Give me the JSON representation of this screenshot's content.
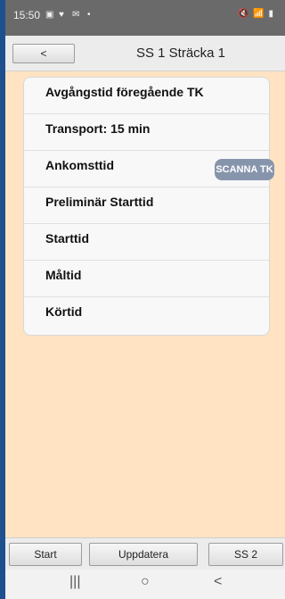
{
  "status_bar": {
    "time": "15:50",
    "notification_icons": [
      "image-icon",
      "twitter-icon",
      "mail-icon",
      "dot-icon"
    ],
    "right_icons": [
      "mute-icon",
      "wifi-icon",
      "volte-icon",
      "signal-icon",
      "battery-icon"
    ]
  },
  "header": {
    "back_label": "<",
    "title": "SS 1 Sträcka 1"
  },
  "card": {
    "rows": [
      {
        "label": "Avgångstid föregående TK"
      },
      {
        "label": "Transport: 15 min"
      },
      {
        "label": "Ankomsttid"
      },
      {
        "label": "Preliminär Starttid"
      },
      {
        "label": "Starttid"
      },
      {
        "label": "Måltid"
      },
      {
        "label": "Körtid"
      }
    ],
    "scan_button": "SCANNA TK"
  },
  "toolbar": {
    "start_label": "Start",
    "update_label": "Uppdatera",
    "next_label": "SS 2"
  },
  "nav": {
    "recent": "|||",
    "home": "○",
    "back": "<"
  },
  "colors": {
    "background": "#ffe3c2",
    "scan_button": "#8795ac",
    "status_bar": "#6a6a6a"
  }
}
